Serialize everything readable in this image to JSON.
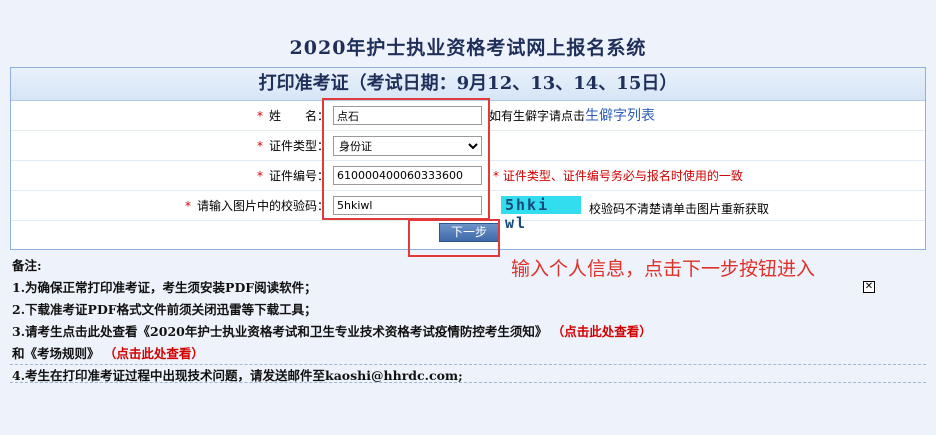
{
  "page": {
    "title": "2020年护士执业资格考试网上报名系统"
  },
  "panel": {
    "header": "打印准考证（考试日期：9月12、13、14、15日）"
  },
  "form": {
    "name": {
      "label": "姓　　名：",
      "value": "点石",
      "hint_prefix": "如有生僻字请点击",
      "hint_link": "生僻字列表"
    },
    "id_type": {
      "label": "证件类型：",
      "value": "身份证",
      "options": [
        "身份证"
      ]
    },
    "id_number": {
      "label": "证件编号：",
      "value": "610000400060333600",
      "hint": "证件类型、证件编号务必与报名时使用的一致"
    },
    "captcha": {
      "label": "请输入图片中的校验码：",
      "value": "5hkiwl",
      "image_text": "5hki wl",
      "hint": "校验码不清楚请单击图片重新获取"
    },
    "required_mark": "*",
    "next_button": "下一步"
  },
  "annotation": {
    "text": "输入个人信息，点击下一步按钮进入"
  },
  "notes": {
    "heading": "备注:",
    "line1": "1.为确保正常打印准考证，考生须安装PDF阅读软件；",
    "line2": "2.下载准考证PDF格式文件前须关闭迅雷等下载工具；",
    "line3_text": "3.请考生点击此处查看《2020年护士执业资格考试和卫生专业技术资格考试疫情防控考生须知》",
    "line3_link": "（点击此处查看）",
    "line4_text": "和《考场规则》",
    "line4_link": "（点击此处查看）",
    "line5": "4.考生在打印准考证过程中出现技术问题，请发送邮件至kaoshi@hhrdc.com;"
  },
  "colors": {
    "accent_red": "#e03a3a",
    "header_text": "#1f2f5a",
    "link_blue": "#2b5eb5"
  }
}
